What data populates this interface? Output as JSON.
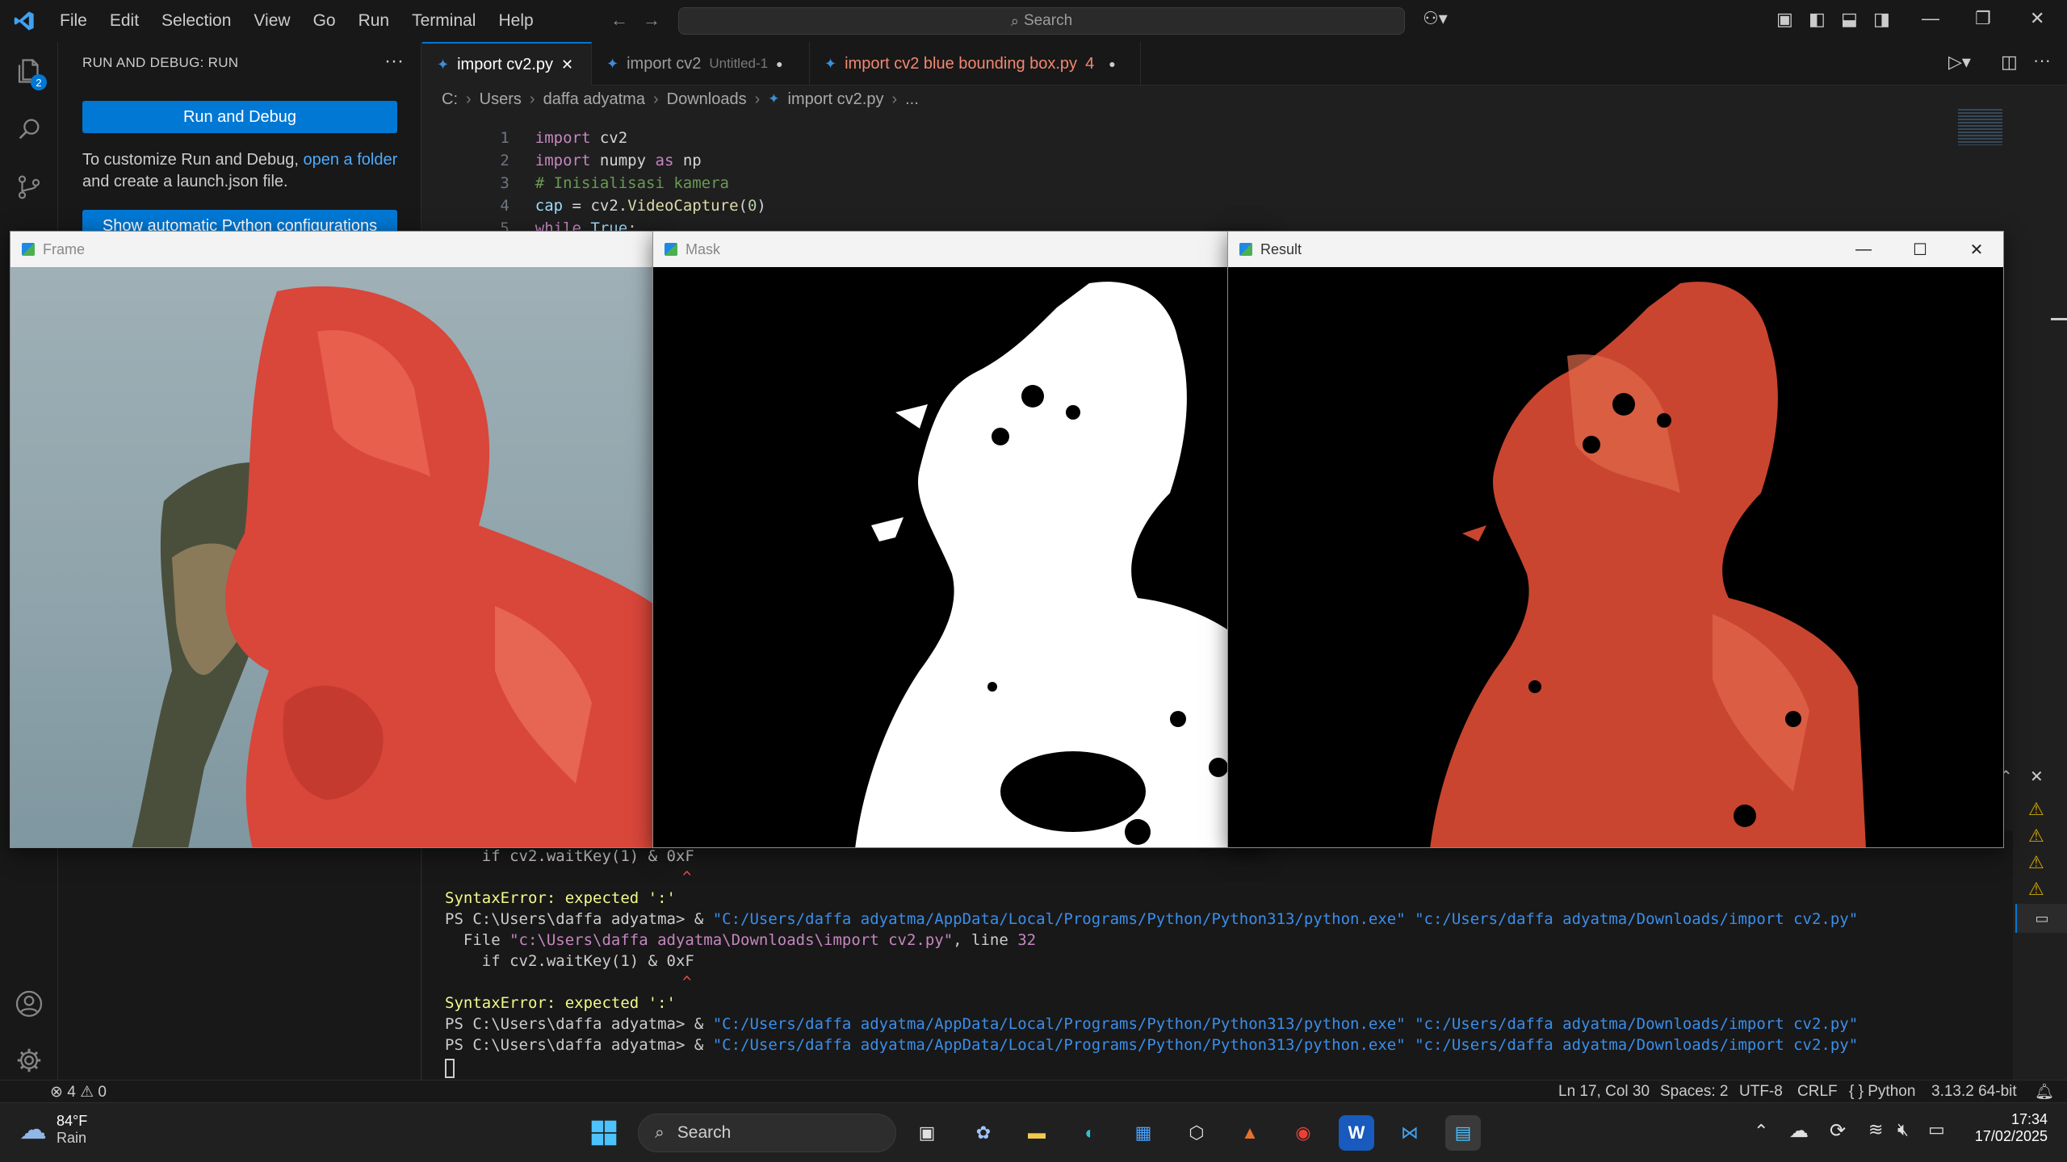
{
  "titlebar": {
    "menu": [
      "File",
      "Edit",
      "Selection",
      "View",
      "Go",
      "Run",
      "Terminal",
      "Help"
    ],
    "search_placeholder": "Search"
  },
  "activitybar": {
    "explorer_badge": "2"
  },
  "sidebar": {
    "title": "RUN AND DEBUG: RUN",
    "run_debug_label": "Run and Debug",
    "desc_prefix": "To customize Run and Debug,",
    "desc_link": "open a folder",
    "desc_suffix": "and create a launch.json file.",
    "show_config_label": "Show automatic Python configurations"
  },
  "tabs": [
    {
      "label": "import cv2.py",
      "subtitle": "",
      "badge": ""
    },
    {
      "label": "import cv2",
      "subtitle": "Untitled-1",
      "badge": ""
    },
    {
      "label": "import cv2 blue bounding box.py",
      "subtitle": "",
      "badge": "4"
    }
  ],
  "breadcrumb": [
    "C:",
    "Users",
    "daffa adyatma",
    "Downloads",
    "import cv2.py",
    "..."
  ],
  "code": {
    "line_numbers": [
      "1",
      "2",
      "3",
      "4",
      "5"
    ],
    "l1_kw": "import",
    "l1_mod": "cv2",
    "l2_kw": "import",
    "l2_mod": "numpy",
    "l2_as": "as",
    "l2_alias": "np",
    "l3_comment": "# Inisialisasi kamera",
    "l4_var": "cap",
    "l4_eq": "=",
    "l4_obj": "cv2",
    "l4_fn": "VideoCapture",
    "l4_arg": "0",
    "l5_kw": "while",
    "l5_val": "True",
    "l5_colon": ":"
  },
  "terminal": {
    "line_a": "    if cv2.waitKey(1) & 0xF",
    "caret": "^",
    "err_label": "SyntaxError",
    "err_msg": ": expected ':'",
    "ps_prompt": "PS C:\\Users\\daffa adyatma> & ",
    "py_exe": "\"C:/Users/daffa adyatma/AppData/Local/Programs/Python/Python313/python.exe\"",
    "script_path": " \"c:/Users/daffa adyatma/Downloads/import cv2.py\"",
    "file_prefix": "  File ",
    "file_path": "\"c:\\Users\\daffa adyatma\\Downloads\\import cv2.py\"",
    "file_line": ", line ",
    "line_no": "32"
  },
  "windows": {
    "frame_title": "Frame",
    "mask_title": "Mask",
    "result_title": "Result"
  },
  "statusbar": {
    "errors": "4",
    "warnings": "0",
    "position": "Ln 17, Col 30",
    "spaces": "Spaces: 2",
    "encoding": "UTF-8",
    "eol": "CRLF",
    "language": "Python",
    "interpreter": "3.13.2 64-bit"
  },
  "taskbar": {
    "weather_temp": "84°F",
    "weather_desc": "Rain",
    "search_label": "Search",
    "time": "17:34",
    "date": "17/02/2025"
  },
  "colors": {
    "accent": "#0078d4",
    "modified_tab": "#f48771",
    "red_plastic": "#e0543a"
  }
}
